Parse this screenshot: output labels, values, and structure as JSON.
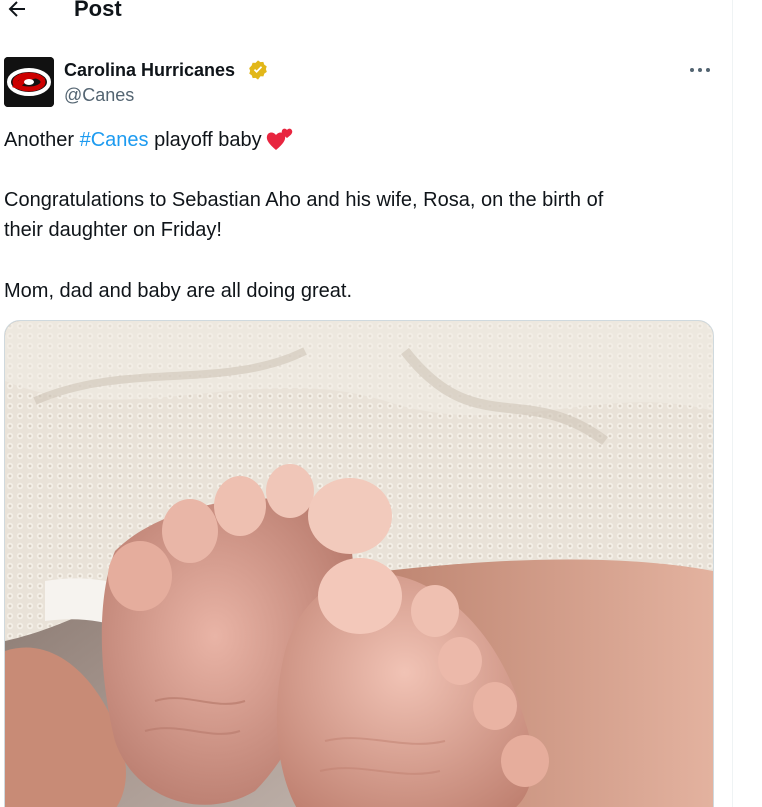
{
  "header": {
    "back_icon": "arrow-left-icon",
    "title": "Post"
  },
  "author": {
    "name": "Carolina Hurricanes",
    "handle": "@Canes",
    "verified_icon": "gold-verified-badge-icon",
    "verified_color": "#e2b719",
    "avatar_icon": "hurricanes-logo-icon"
  },
  "more_icon": "more-dots-icon",
  "tweet": {
    "line1_prefix": "Another ",
    "hashtag": "#Canes",
    "line1_suffix": " playoff baby",
    "line1_emoji": "two-hearts-emoji",
    "line2": "Congratulations to Sebastian Aho and his wife, Rosa, on the birth of",
    "line3": "their daughter on Friday!",
    "line4": "Mom, dad and baby are all doing great."
  },
  "colors": {
    "link": "#1d9bf0",
    "text": "#0f1419",
    "secondary": "#536471"
  }
}
